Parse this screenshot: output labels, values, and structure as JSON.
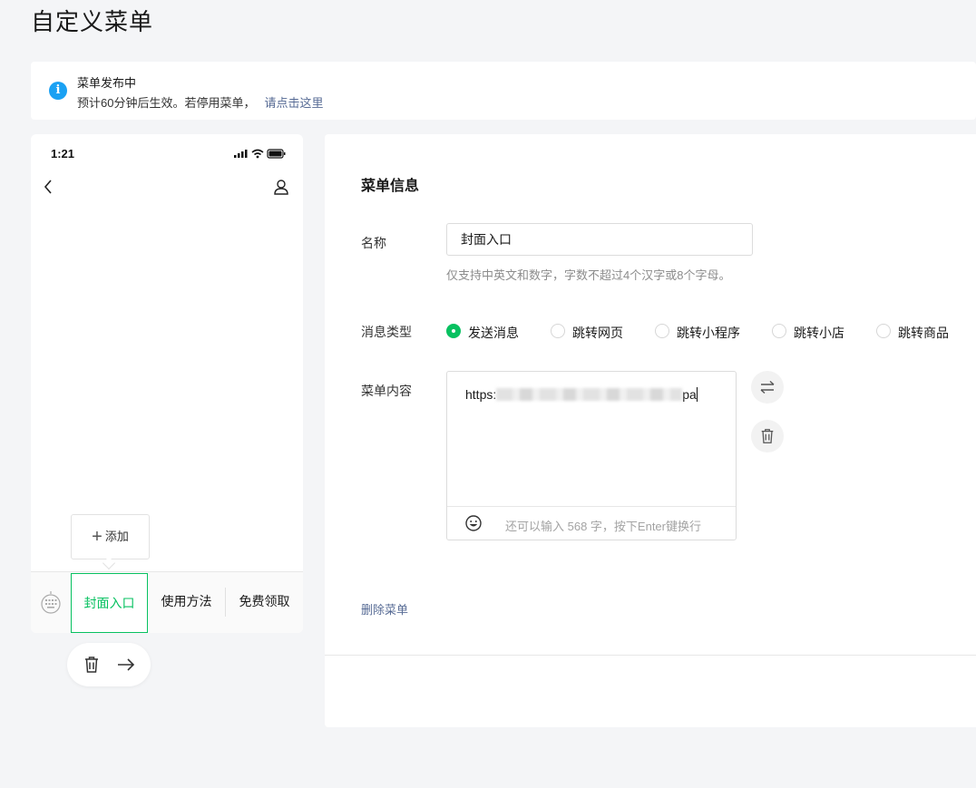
{
  "page": {
    "title": "自定义菜单"
  },
  "notice": {
    "title": "菜单发布中",
    "desc": "预计60分钟后生效。若停用菜单，",
    "link": "请点击这里",
    "icon": "info-icon",
    "icon_color": "#1aa1f3"
  },
  "phone": {
    "time": "1:21",
    "add_label": "添加",
    "menu_items": [
      {
        "label": "封面入口",
        "active": true
      },
      {
        "label": "使用方法",
        "active": false
      },
      {
        "label": "免费领取",
        "active": false
      }
    ],
    "accent": "#07c160"
  },
  "panel": {
    "section_title": "菜单信息",
    "name_label": "名称",
    "name_value": "封面入口",
    "name_hint": "仅支持中英文和数字，字数不超过4个汉字或8个字母。",
    "type_label": "消息类型",
    "types": [
      {
        "label": "发送消息",
        "checked": true
      },
      {
        "label": "跳转网页",
        "checked": false
      },
      {
        "label": "跳转小程序",
        "checked": false
      },
      {
        "label": "跳转小店",
        "checked": false
      },
      {
        "label": "跳转商品",
        "checked": false
      }
    ],
    "content_label": "菜单内容",
    "content_prefix": "https:",
    "content_suffix": "pa",
    "counter": "还可以输入 568 字，按下Enter键换行",
    "delete_label": "删除菜单",
    "link_color": "#576b95"
  }
}
